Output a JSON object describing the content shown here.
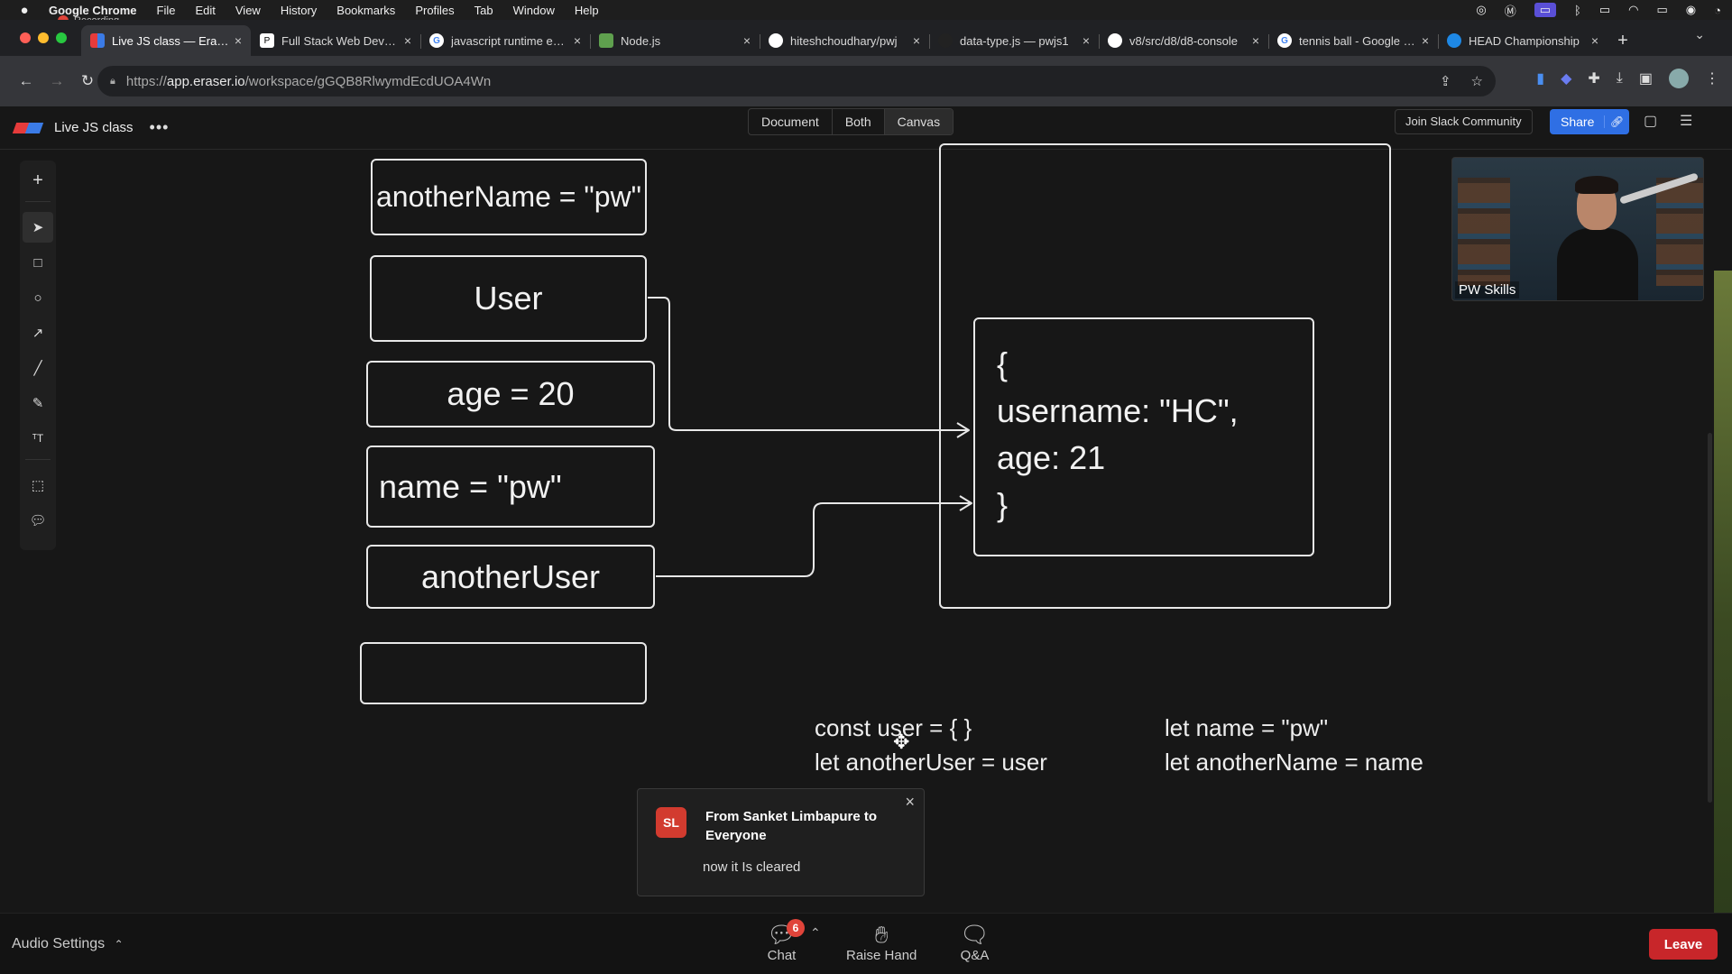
{
  "menubar": {
    "app_name": "Google Chrome",
    "items": [
      "File",
      "Edit",
      "View",
      "History",
      "Bookmarks",
      "Profiles",
      "Tab",
      "Window",
      "Help"
    ],
    "recording_label": "Recording"
  },
  "tabs": [
    {
      "title": "Live JS class — Eraser",
      "active": true,
      "icon": "eraser-icon"
    },
    {
      "title": "Full Stack Web Development",
      "icon": "pw-icon"
    },
    {
      "title": "javascript runtime engine",
      "icon": "google-icon"
    },
    {
      "title": "Node.js",
      "icon": "node-icon"
    },
    {
      "title": "hiteshchoudhary/pwj",
      "icon": "github-icon"
    },
    {
      "title": "data-type.js — pwjs1",
      "icon": "code-icon"
    },
    {
      "title": "v8/src/d8/d8-console",
      "icon": "github-icon"
    },
    {
      "title": "tennis ball - Google Search",
      "icon": "google-icon"
    },
    {
      "title": "HEAD Championship",
      "icon": "head-icon"
    }
  ],
  "omnibox": {
    "scheme": "https://",
    "host": "app.eraser.io",
    "path": "/workspace/gGQB8RlwymdEcdUOA4Wn"
  },
  "app": {
    "doc_title": "Live JS class",
    "modes": [
      {
        "label": "Document"
      },
      {
        "label": "Both"
      },
      {
        "label": "Canvas",
        "selected": true
      }
    ],
    "slack_label": "Join Slack Community",
    "share_label": "Share"
  },
  "canvas": {
    "boxes": {
      "another_name": "anotherName = \"pw\"",
      "user": "User",
      "age": "age = 20",
      "name": "name = \"pw\"",
      "another_user": "anotherUser",
      "empty": ""
    },
    "object_lines": [
      "{",
      "username: \"HC\",",
      "age: 21",
      "}"
    ],
    "code_left": [
      "const user = { }",
      "let anotherUser = user"
    ],
    "code_right": [
      "let name = \"pw\"",
      "let anotherName = name"
    ]
  },
  "webcam": {
    "label": "PW Skills"
  },
  "toast": {
    "initials": "SL",
    "from": "From Sanket Limbapure to Everyone",
    "message": "now it Is cleared"
  },
  "meeting": {
    "audio_label": "Audio Settings",
    "chat_label": "Chat",
    "chat_badge": "6",
    "raise_hand_label": "Raise Hand",
    "qa_label": "Q&A",
    "leave_label": "Leave"
  }
}
